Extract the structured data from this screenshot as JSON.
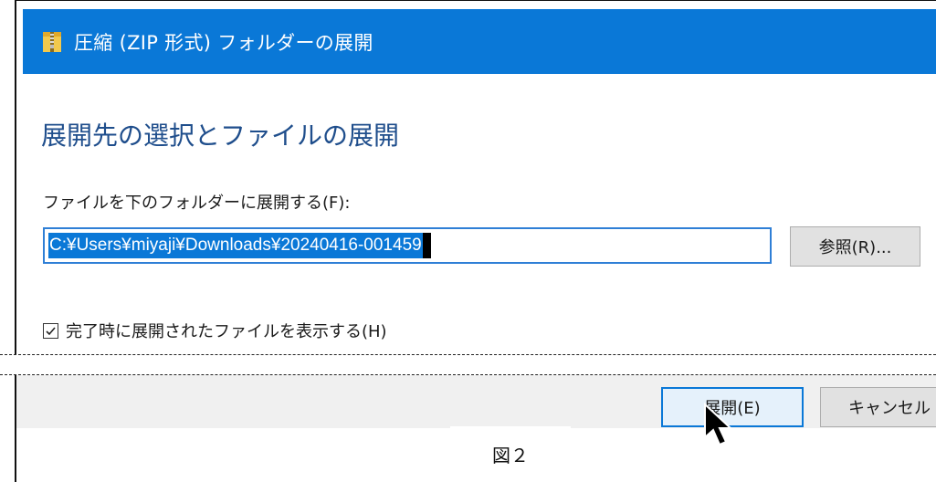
{
  "window": {
    "title": "圧縮 (ZIP 形式) フォルダーの展開",
    "icon": "zip-folder-icon"
  },
  "dialog": {
    "heading": "展開先の選択とファイルの展開",
    "path_label": "ファイルを下のフォルダーに展開する(F):",
    "path_value": "C:¥Users¥miyaji¥Downloads¥20240416-001459",
    "browse_label": "参照(R)...",
    "show_files_label": "完了時に展開されたファイルを表示する(H)",
    "show_files_checked": true
  },
  "footer": {
    "extract_label": "展開(E)",
    "cancel_label": "キャンセル"
  },
  "caption": "図２",
  "colors": {
    "titlebar": "#0a78d7",
    "heading": "#1f4e8c",
    "selection": "#0a78d7"
  }
}
